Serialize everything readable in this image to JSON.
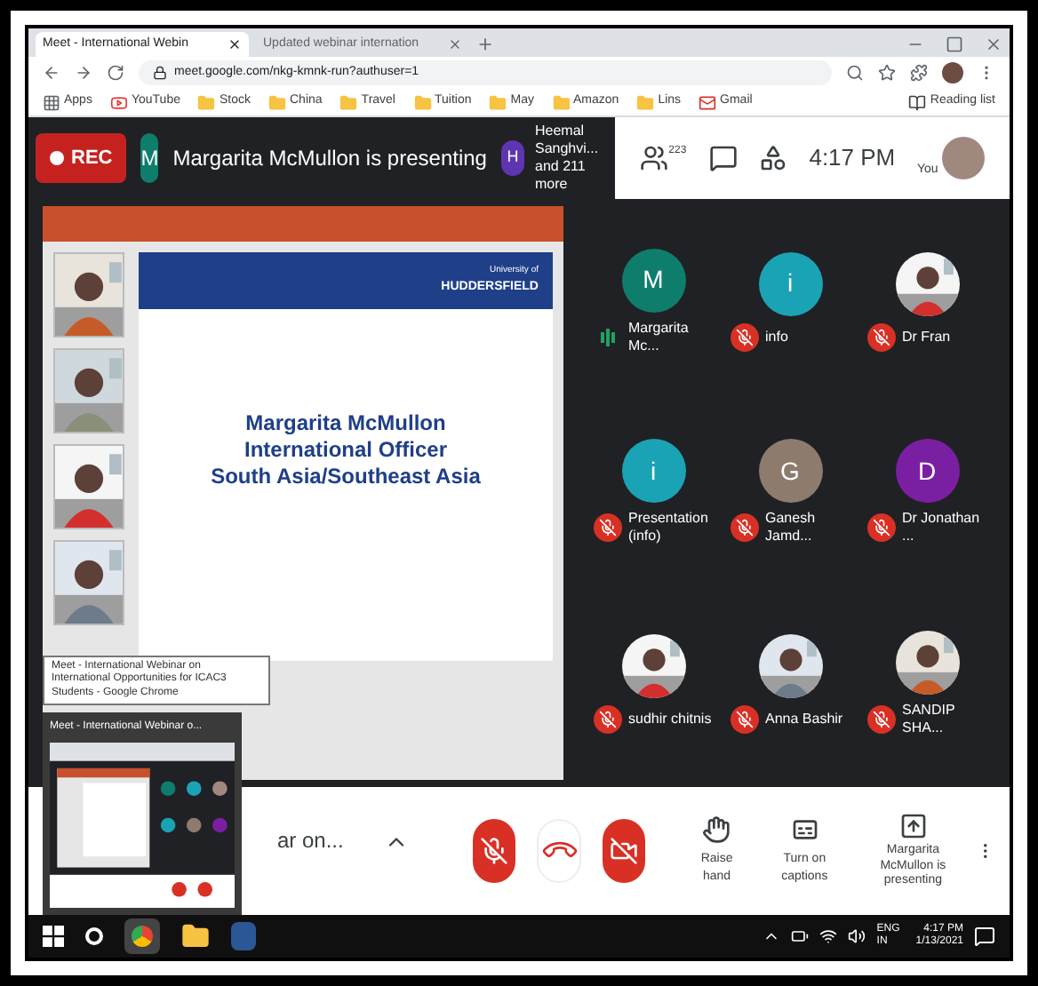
{
  "browser": {
    "tabs": [
      {
        "label": "Meet - International Webin",
        "selected": true
      },
      {
        "label": "Updated webinar internation",
        "selected": false
      }
    ],
    "url": "meet.google.com/nkg-kmnk-run?authuser=1",
    "bookmarks": [
      {
        "label": "Apps",
        "kind": "apps"
      },
      {
        "label": "YouTube",
        "kind": "youtube"
      },
      {
        "label": "Stock",
        "kind": "folder"
      },
      {
        "label": "China",
        "kind": "folder"
      },
      {
        "label": "Travel",
        "kind": "folder"
      },
      {
        "label": "Tuition",
        "kind": "folder"
      },
      {
        "label": "May",
        "kind": "folder"
      },
      {
        "label": "Amazon",
        "kind": "folder"
      },
      {
        "label": "Lins",
        "kind": "folder"
      },
      {
        "label": "Gmail",
        "kind": "gmail"
      }
    ],
    "reading_list": "Reading list"
  },
  "meet": {
    "recording": true,
    "rec_label": "REC",
    "presenter_avatar": "M",
    "presenter_banner": "Margarita McMullon is presenting",
    "participant_avatar": "H",
    "participant_name": "Heemal Sanghvi...",
    "participant_more": "and 211 more",
    "people_count": "223",
    "time": "4:17 PM",
    "self_label": "You"
  },
  "slide": {
    "logo_line1": "University of",
    "logo_line2": "HUDDERSFIELD",
    "lines": [
      "Margarita McMullon",
      "International Officer",
      "South Asia/Southeast Asia"
    ]
  },
  "tooltip": "Meet - International Webinar on International Opportunities for ICAC3 Students - Google Chrome",
  "preview_title": "Meet - International Webinar o...",
  "cut_label": "ar on...",
  "participants": [
    {
      "name": "Margarita Mc...",
      "kind": "letter",
      "initial": "M",
      "color": "#0f7d6c",
      "muted": false
    },
    {
      "name": "info",
      "kind": "letter",
      "initial": "i",
      "color": "#1aa3b5",
      "muted": true
    },
    {
      "name": "Dr Fran",
      "muted": true
    },
    {
      "name": "Presentation (info)",
      "kind": "letter",
      "initial": "i",
      "color": "#1aa3b5",
      "muted": true
    },
    {
      "name": "Ganesh Jamd...",
      "kind": "letter",
      "initial": "G",
      "color": "#8d7b6e",
      "muted": true
    },
    {
      "name": "Dr Jonathan ...",
      "kind": "letter",
      "initial": "D",
      "color": "#7b1fa2",
      "muted": true
    },
    {
      "name": "sudhir chitnis",
      "muted": true
    },
    {
      "name": "Anna Bashir",
      "muted": true
    },
    {
      "name": "SANDIP SHA...",
      "muted": true
    }
  ],
  "controls": {
    "mic_on": false,
    "camera_on": false,
    "raise_hand": "Raise hand",
    "captions": "Turn on captions",
    "presenting": "Margarita McMullon is presenting"
  },
  "taskbar": {
    "lang": "ENG IN",
    "time": "4:17 PM",
    "date": "1/13/2021"
  }
}
